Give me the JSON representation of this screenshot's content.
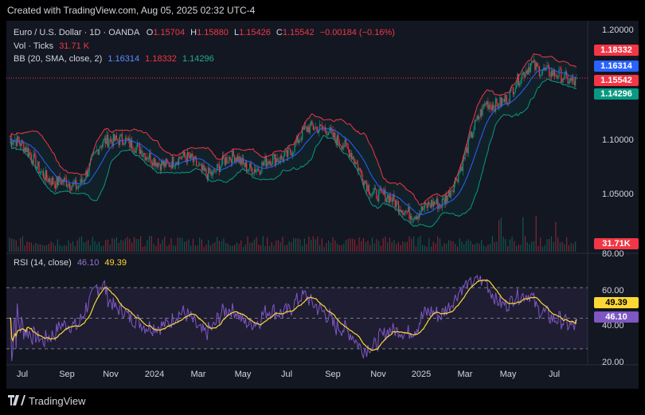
{
  "header": {
    "text": "Created with TradingView.com, Aug 05, 2025 02:32 UTC-4"
  },
  "footer": {
    "brand": "TradingView",
    "logo_icon": "tradingview-logo-icon"
  },
  "legend": {
    "symbol": "Euro / U.S. Dollar · 1D · OANDA",
    "o_label": "O",
    "o_value": "1.15704",
    "h_label": "H",
    "h_value": "1.15880",
    "l_label": "L",
    "l_value": "1.15426",
    "c_label": "C",
    "c_value": "1.15542",
    "change": "−0.00184 (−0.16%)",
    "vol_label": "Vol · Ticks",
    "vol_value": "31.71 K",
    "bb_label": "BB (20, SMA, close, 2)",
    "bb_basis": "1.16314",
    "bb_upper": "1.18332",
    "bb_lower": "1.14296",
    "rsi_label": "RSI (14, close)",
    "rsi_value": "46.10",
    "rsi_ma": "49.39"
  },
  "colors": {
    "up": "#089981",
    "down": "#f23645",
    "bb_basis": "#2962ff",
    "bb_upper": "#f23645",
    "bb_lower": "#089981",
    "rsi": "#7e57c2",
    "rsi_ma": "#fdd835",
    "background": "#131722"
  },
  "price_boxes": {
    "upper": "1.18332",
    "basis": "1.16314",
    "close": "1.15542",
    "lower": "1.14296",
    "volume": "31.71K",
    "rsi_ma": "49.39",
    "rsi": "46.10"
  },
  "chart_data": [
    {
      "type": "candlestick",
      "title": "Euro / U.S. Dollar · 1D · OANDA",
      "x_axis": {
        "tick_labels": [
          "Jul",
          "Sep",
          "Nov",
          "2024",
          "Mar",
          "May",
          "Jul",
          "Sep",
          "Nov",
          "2025",
          "Mar",
          "May",
          "Jul"
        ]
      },
      "y_axis": {
        "tick_labels": [
          "1.20000",
          "1.10000",
          "1.05000"
        ],
        "range": [
          1.0,
          1.2
        ],
        "position": "right"
      },
      "series": [
        {
          "name": "BB basis",
          "last": 1.16314
        },
        {
          "name": "BB upper",
          "last": 1.18332
        },
        {
          "name": "BB lower",
          "last": 1.14296
        }
      ],
      "monthly_close": [
        [
          "2023-07",
          1.1
        ],
        [
          "2023-08",
          1.085
        ],
        [
          "2023-09",
          1.058
        ],
        [
          "2023-10",
          1.06
        ],
        [
          "2023-11",
          1.092
        ],
        [
          "2023-12",
          1.105
        ],
        [
          "2024-01",
          1.082
        ],
        [
          "2024-02",
          1.081
        ],
        [
          "2024-03",
          1.08
        ],
        [
          "2024-04",
          1.07
        ],
        [
          "2024-05",
          1.085
        ],
        [
          "2024-06",
          1.072
        ],
        [
          "2024-07",
          1.085
        ],
        [
          "2024-08",
          1.105
        ],
        [
          "2024-09",
          1.113
        ],
        [
          "2024-10",
          1.085
        ],
        [
          "2024-11",
          1.055
        ],
        [
          "2024-12",
          1.04
        ],
        [
          "2025-01",
          1.035
        ],
        [
          "2025-02",
          1.04
        ],
        [
          "2025-03",
          1.08
        ],
        [
          "2025-04",
          1.135
        ],
        [
          "2025-05",
          1.135
        ],
        [
          "2025-06",
          1.172
        ],
        [
          "2025-07",
          1.155
        ],
        [
          "2025-08",
          1.15542
        ]
      ],
      "last_close": 1.15542
    },
    {
      "type": "bar",
      "title": "Vol · Ticks",
      "last": "31.71K"
    },
    {
      "type": "line",
      "title": "RSI (14, close)",
      "y_axis": {
        "tick_labels": [
          "80.00",
          "60.00",
          "40.00",
          "20.00"
        ],
        "range": [
          20,
          80
        ]
      },
      "series": [
        {
          "name": "RSI",
          "last": 46.1
        },
        {
          "name": "RSI MA",
          "last": 49.39
        }
      ],
      "bands": [
        70,
        30
      ]
    }
  ]
}
